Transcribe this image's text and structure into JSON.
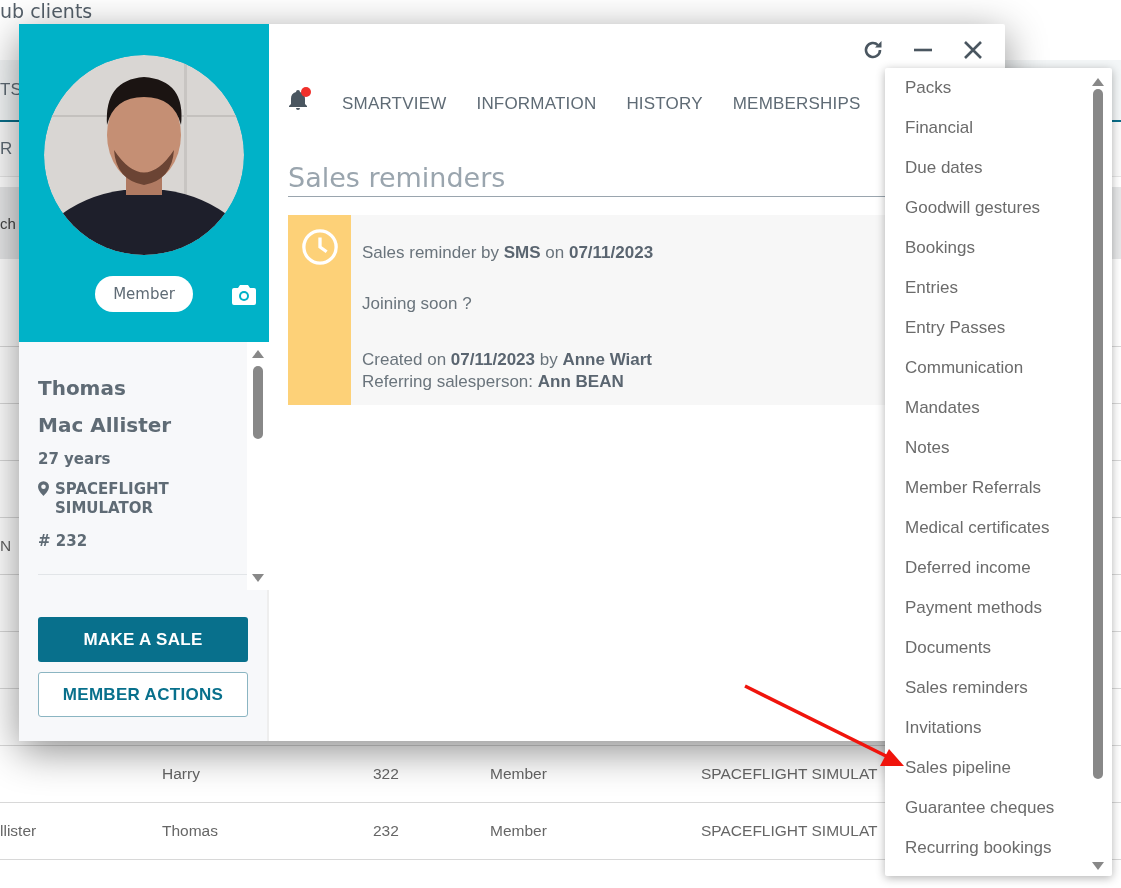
{
  "background": {
    "title": "ub clients",
    "tab_fragment": "TS",
    "subtab_fragment": "R",
    "search_fragment": "ch",
    "row_fragment": "N",
    "rows": [
      {
        "column_2": "Harry",
        "column_3": "322",
        "column_4": "Member",
        "column_5": "SPACEFLIGHT SIMULAT"
      },
      {
        "column_1": "llister",
        "column_2": "Thomas",
        "column_3": "232",
        "column_4": "Member",
        "column_5": "SPACEFLIGHT SIMULAT"
      }
    ]
  },
  "member": {
    "status": "Member",
    "first_name": "Thomas",
    "last_name": "Mac Allister",
    "age": "27 years",
    "location": "SPACEFLIGHT SIMULATOR",
    "number": "# 232"
  },
  "actions": [
    "MAKE A SALE",
    "MEMBER ACTIONS"
  ],
  "notifications": {
    "unread": true
  },
  "tabs": [
    {
      "label": "SMARTVIEW",
      "selected": false
    },
    {
      "label": "INFORMATION",
      "selected": false
    },
    {
      "label": "HISTORY",
      "selected": false
    },
    {
      "label": "MEMBERSHIPS",
      "selected": false
    }
  ],
  "section_title": "Sales reminders",
  "reminder": {
    "headline": "Sales reminder by **SMS** on **07/11/2023**",
    "message": "Joining soon ?",
    "created": "Created on **07/11/2023** by **Anne Wiart**",
    "salesperson": "Referring salesperson: **Ann BEAN**"
  },
  "menu": [
    "Packs",
    "Financial",
    "Due dates",
    "Goodwill gestures",
    "Bookings",
    "Entries",
    "Entry Passes",
    "Communication",
    "Mandates",
    "Notes",
    "Member Referrals",
    "Medical certificates",
    "Deferred income",
    "Payment methods",
    "Documents",
    "Sales reminders",
    "Invitations",
    "Sales pipeline",
    "Guarantee cheques",
    "Recurring bookings"
  ]
}
